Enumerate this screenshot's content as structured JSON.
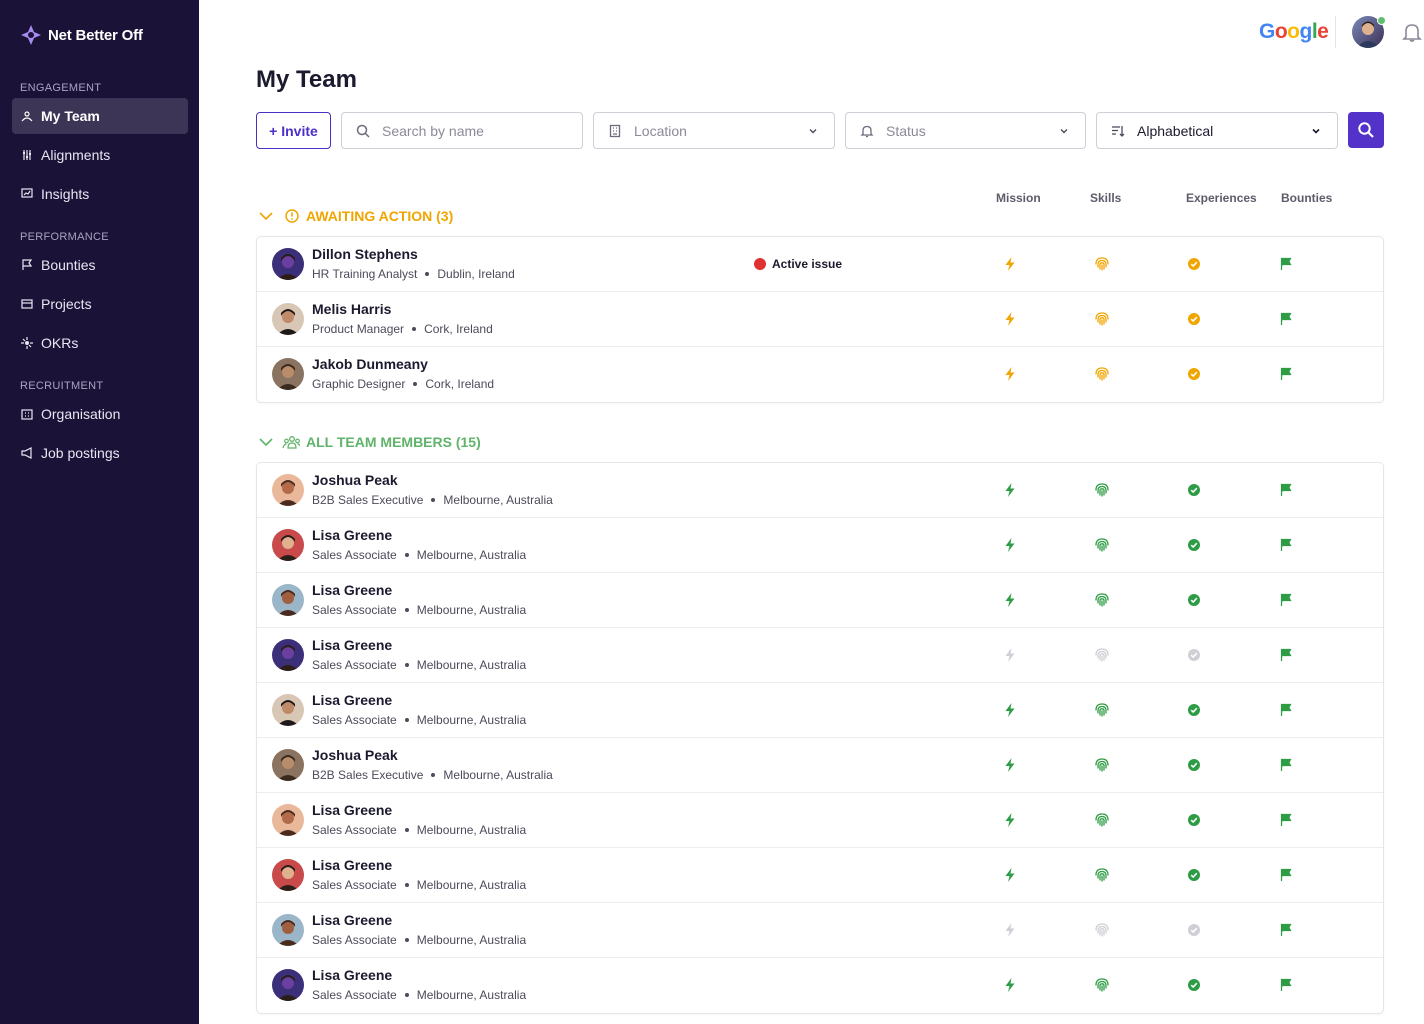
{
  "brand": {
    "name": "Net Better Off"
  },
  "sidebar": {
    "sections": [
      {
        "title": "ENGAGEMENT"
      },
      {
        "title": "PERFORMANCE"
      },
      {
        "title": "RECRUITMENT"
      }
    ],
    "items": [
      {
        "label": "My Team",
        "icon": "team-icon",
        "active": true
      },
      {
        "label": "Alignments",
        "icon": "sliders-icon"
      },
      {
        "label": "Insights",
        "icon": "chart-icon"
      },
      {
        "label": "Bounties",
        "icon": "flag-icon"
      },
      {
        "label": "Projects",
        "icon": "projects-icon"
      },
      {
        "label": "OKRs",
        "icon": "target-icon"
      },
      {
        "label": "Organisation",
        "icon": "building-icon"
      },
      {
        "label": "Job postings",
        "icon": "megaphone-icon"
      }
    ]
  },
  "header": {
    "google_label": "Google"
  },
  "page": {
    "title": "My Team"
  },
  "toolbar": {
    "invite_label": "+ Invite",
    "search_placeholder": "Search by name",
    "location_placeholder": "Location",
    "status_placeholder": "Status",
    "sort_value": "Alphabetical"
  },
  "columns": {
    "mission": "Mission",
    "skills": "Skills",
    "experiences": "Experiences",
    "bounties": "Bounties"
  },
  "colors": {
    "accent": "#5232c8",
    "awaiting": "#f0a500",
    "members": "#5fb36a",
    "green": "#2e9c44",
    "grey": "#cfcfd6",
    "issue": "#e03131"
  },
  "awaiting": {
    "label": "AWAITING ACTION (3)",
    "rows": [
      {
        "name": "Dillon Stephens",
        "role": "HR Training Analyst",
        "location": "Dublin, Ireland",
        "issue": "Active issue",
        "status": "pending"
      },
      {
        "name": "Melis Harris",
        "role": "Product Manager",
        "location": "Cork, Ireland",
        "issue": "",
        "status": "pending"
      },
      {
        "name": "Jakob Dunmeany",
        "role": "Graphic Designer",
        "location": "Cork, Ireland",
        "issue": "",
        "status": "pending"
      }
    ]
  },
  "members": {
    "label": "ALL TEAM MEMBERS (15)",
    "rows": [
      {
        "name": "Joshua Peak",
        "role": "B2B Sales Executive",
        "location": "Melbourne, Australia",
        "status": "done"
      },
      {
        "name": "Lisa Greene",
        "role": "Sales Associate",
        "location": "Melbourne, Australia",
        "status": "done"
      },
      {
        "name": "Lisa Greene",
        "role": "Sales Associate",
        "location": "Melbourne, Australia",
        "status": "done"
      },
      {
        "name": "Lisa Greene",
        "role": "Sales Associate",
        "location": "Melbourne, Australia",
        "status": "inactive"
      },
      {
        "name": "Lisa Greene",
        "role": "Sales Associate",
        "location": "Melbourne, Australia",
        "status": "done"
      },
      {
        "name": "Joshua Peak",
        "role": "B2B Sales Executive",
        "location": "Melbourne, Australia",
        "status": "done"
      },
      {
        "name": "Lisa Greene",
        "role": "Sales Associate",
        "location": "Melbourne, Australia",
        "status": "done"
      },
      {
        "name": "Lisa Greene",
        "role": "Sales Associate",
        "location": "Melbourne, Australia",
        "status": "done"
      },
      {
        "name": "Lisa Greene",
        "role": "Sales Associate",
        "location": "Melbourne, Australia",
        "status": "inactive"
      },
      {
        "name": "Lisa Greene",
        "role": "Sales Associate",
        "location": "Melbourne, Australia",
        "status": "done"
      }
    ]
  }
}
